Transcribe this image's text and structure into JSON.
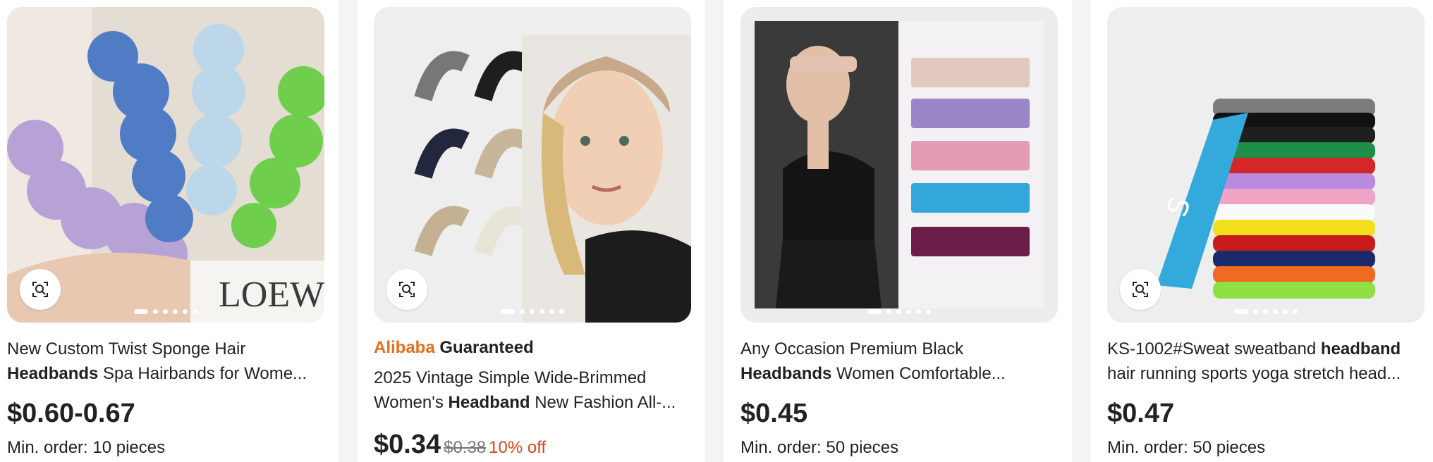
{
  "products": [
    {
      "title_line1": "New Custom Twist Sponge Hair",
      "title_bold": "Headbands",
      "title_line2_rest": " Spa Hairbands for Wome...",
      "price": "$0.60-0.67",
      "moq": "Min. order: 10 pieces",
      "image_icon": "twist-sponge-headbands-image"
    },
    {
      "badge_brand": "Alibaba",
      "badge_label": "Guaranteed",
      "title_line1": "2025 Vintage Simple Wide-Brimmed",
      "title_line2_pre": "Women's ",
      "title_bold": "Headband",
      "title_line2_rest": " New Fashion All-...",
      "price": "$0.34",
      "old_price": "$0.38",
      "discount": "10% off",
      "image_icon": "wide-headbands-model-image"
    },
    {
      "title_line1": "Any Occasion Premium Black",
      "title_bold": "Headbands",
      "title_line2_rest": " Women Comfortable...",
      "price": "$0.45",
      "moq": "Min. order: 50 pieces",
      "image_icon": "sport-headband-woman-image"
    },
    {
      "title_line1_pre": "KS-1002#Sweat sweatband ",
      "title_bold": "headband",
      "title_line2": "hair running sports yoga stretch head...",
      "price": "$0.47",
      "moq": "Min. order: 50 pieces",
      "image_icon": "stacked-sweatbands-image"
    }
  ],
  "colors": {
    "brand_orange": "#e36e1f",
    "discount_red": "#d6441c",
    "text": "#222222"
  }
}
